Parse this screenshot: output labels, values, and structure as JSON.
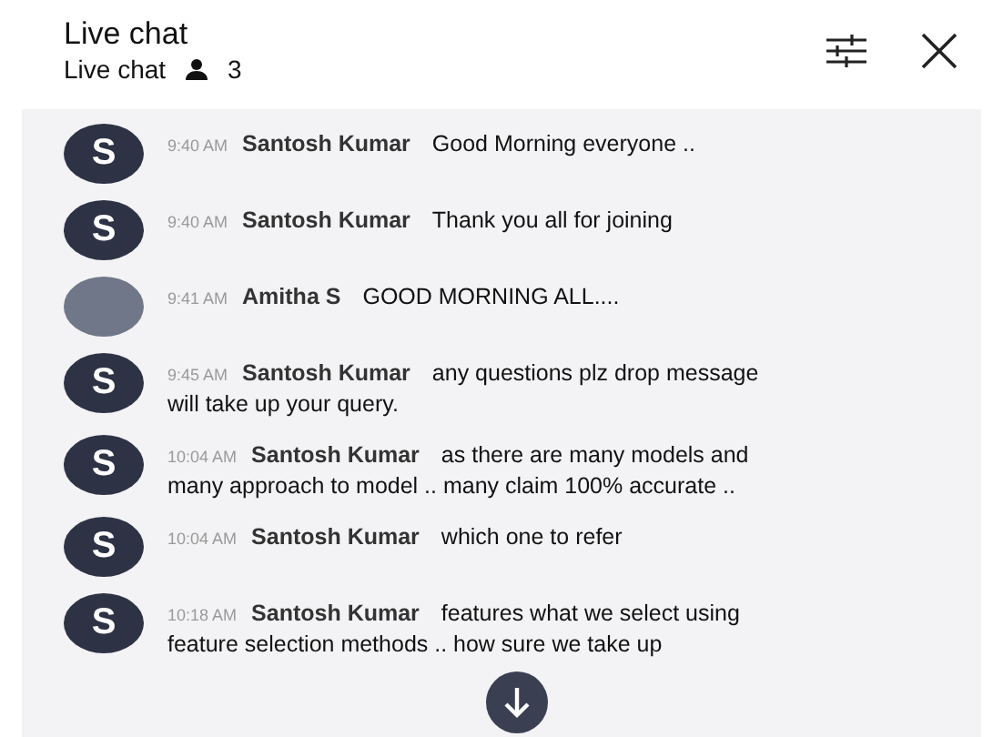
{
  "header": {
    "title": "Live chat",
    "subtitle": "Live chat",
    "viewers": "3"
  },
  "messages": [
    {
      "avatar": {
        "kind": "letter",
        "letter": "S"
      },
      "time": "9:40 AM",
      "author": "Santosh Kumar",
      "text": "Good Morning everyone .."
    },
    {
      "avatar": {
        "kind": "letter",
        "letter": "S"
      },
      "time": "9:40 AM",
      "author": "Santosh Kumar",
      "text": "Thank you all for joining"
    },
    {
      "avatar": {
        "kind": "photo"
      },
      "time": "9:41 AM",
      "author": "Amitha S",
      "text": "GOOD MORNING ALL...."
    },
    {
      "avatar": {
        "kind": "letter",
        "letter": "S"
      },
      "time": "9:45 AM",
      "author": "Santosh Kumar",
      "text": "any questions plz drop message will take up your query."
    },
    {
      "avatar": {
        "kind": "letter",
        "letter": "S"
      },
      "time": "10:04 AM",
      "author": "Santosh Kumar",
      "text": "as there are many models and many approach to model .. many claim 100% accurate .."
    },
    {
      "avatar": {
        "kind": "letter",
        "letter": "S"
      },
      "time": "10:04 AM",
      "author": "Santosh Kumar",
      "text": "which one to refer"
    },
    {
      "avatar": {
        "kind": "letter",
        "letter": "S"
      },
      "time": "10:18 AM",
      "author": "Santosh Kumar",
      "text": "features what we select using feature selection methods .. how sure we take up"
    }
  ]
}
